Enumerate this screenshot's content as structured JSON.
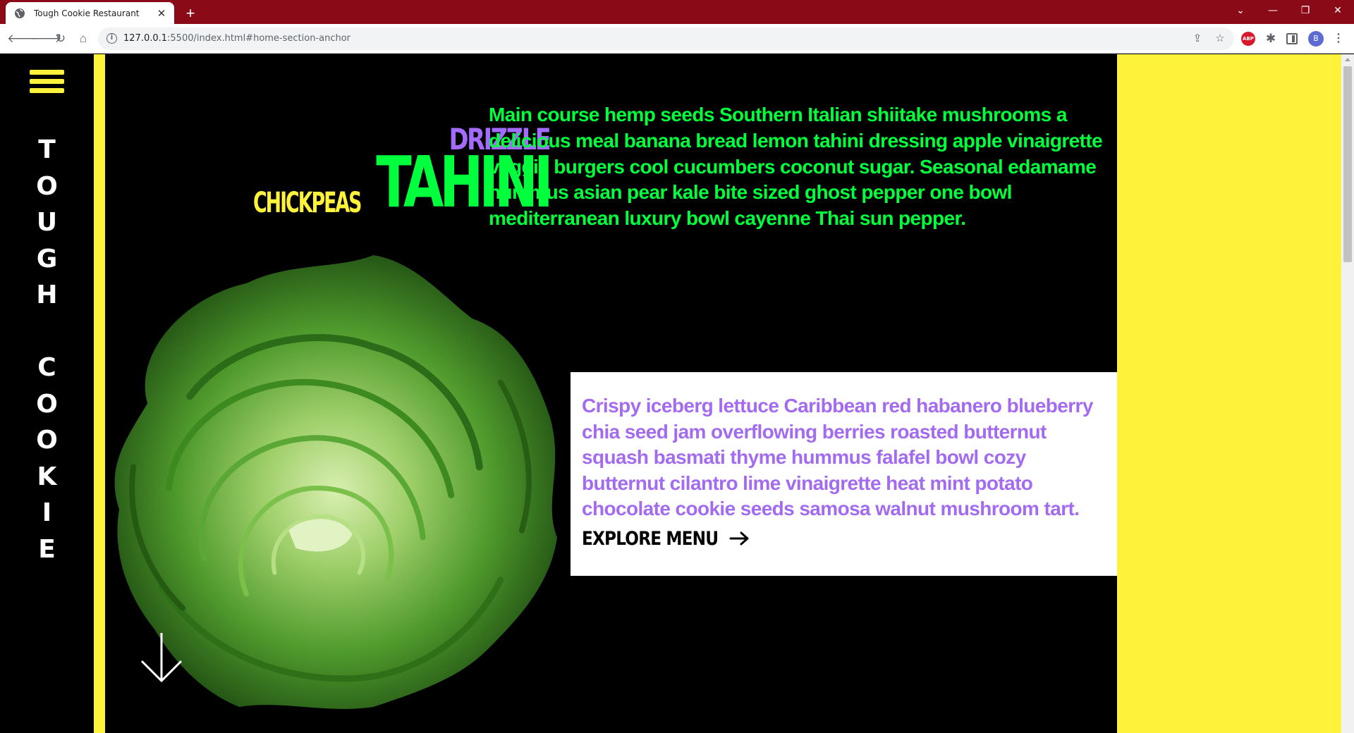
{
  "browser": {
    "tab_title": "Tough Cookie Restaurant",
    "url_host": "127.0.0.1",
    "url_rest": ":5500/index.html#home-section-anchor",
    "avatar_letter": "B",
    "abp_label": "ABP"
  },
  "site": {
    "name_letters": [
      "T",
      "O",
      "U",
      "G",
      "H",
      "",
      "C",
      "O",
      "O",
      "K",
      "I",
      "E"
    ],
    "accent_yellow": "#fff23a",
    "accent_green": "#00ff3c",
    "accent_purple": "#a36bff"
  },
  "hero": {
    "word_top": "DRIZZLE",
    "word_main": "TAHINI",
    "word_bottom": "CHICKPEAS",
    "intro": "Main course hemp seeds Southern Italian shiitake mushrooms a delicious meal banana bread lemon tahini dressing apple vinaigrette veggie burgers cool cucumbers coconut sugar. Seasonal edamame hummus asian pear kale bite sized ghost pepper one bowl mediterranean luxury bowl cayenne Thai sun pepper.",
    "card_text": "Crispy iceberg lettuce Caribbean red habanero blueberry chia seed jam overflowing berries roasted butternut squash basmati thyme hummus falafel bowl cozy butternut cilantro lime vinaigrette heat mint potato chocolate cookie seeds samosa walnut mushroom tart.",
    "cta_label": "EXPLORE MENU"
  }
}
